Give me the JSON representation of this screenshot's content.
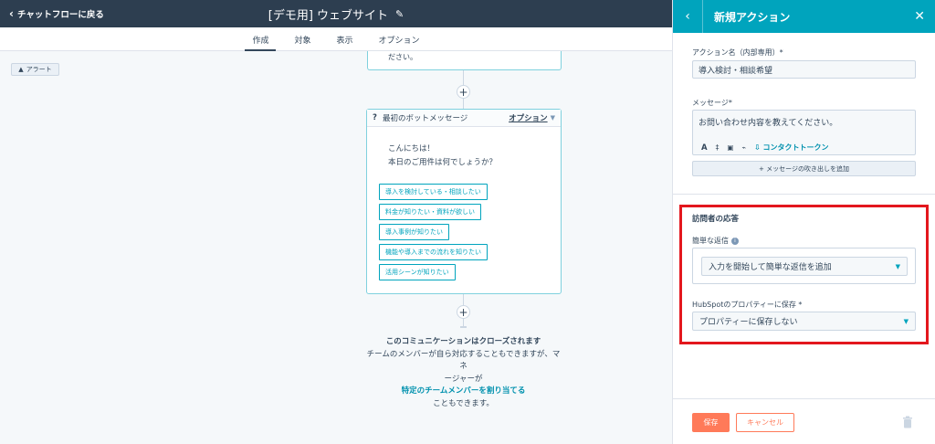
{
  "topbar": {
    "back_label": "チャットフローに戻る",
    "title": "[デモ用] ウェブサイト"
  },
  "tabs": [
    {
      "label": "作成",
      "active": true
    },
    {
      "label": "対象",
      "active": false
    },
    {
      "label": "表示",
      "active": false
    },
    {
      "label": "オプション",
      "active": false
    }
  ],
  "canvas": {
    "alert_label": "アラート",
    "prev_card_text": "ださい。",
    "bot_card": {
      "icon": "?",
      "title": "最初のボットメッセージ",
      "options_label": "オプション",
      "message_line1": "こんにちは！",
      "message_line2": "本日のご用件は何でしょうか？",
      "choices": [
        "導入を検討している・相談したい",
        "料金が知りたい・資料が欲しい",
        "導入事例が知りたい",
        "機能や導入までの流れを知りたい",
        "活用シーンが知りたい"
      ]
    },
    "closing": {
      "title": "このコミュニケーションはクローズされます",
      "line1": "チームのメンバーが自ら対応することもできますが、マネ",
      "line2": "ージャーが",
      "link": "特定のチームメンバーを割り当てる",
      "line3": "こともできます。"
    }
  },
  "panel": {
    "title": "新規アクション",
    "action_name_label": "アクション名（内部専用）*",
    "action_name_value": "導入検討・相談希望",
    "message_label": "メッセージ*",
    "message_value": "お問い合わせ内容を教えてください。",
    "contact_token_label": "コンタクトトークン",
    "add_bubble_label": "+ メッセージの吹き出しを追加",
    "visitor_response_title": "訪問者の応答",
    "quick_reply_label": "簡単な返信",
    "quick_reply_placeholder": "入力を開始して簡単な返信を追加",
    "hubspot_property_label": "HubSpotのプロパティーに保存 *",
    "hubspot_property_value": "プロパティーに保存しない",
    "save_label": "保存",
    "cancel_label": "キャンセル"
  },
  "colors": {
    "topbar": "#2d3e50",
    "accent_teal": "#00a4bd",
    "save_orange": "#ff7a59",
    "highlight_red": "#e3171d"
  }
}
